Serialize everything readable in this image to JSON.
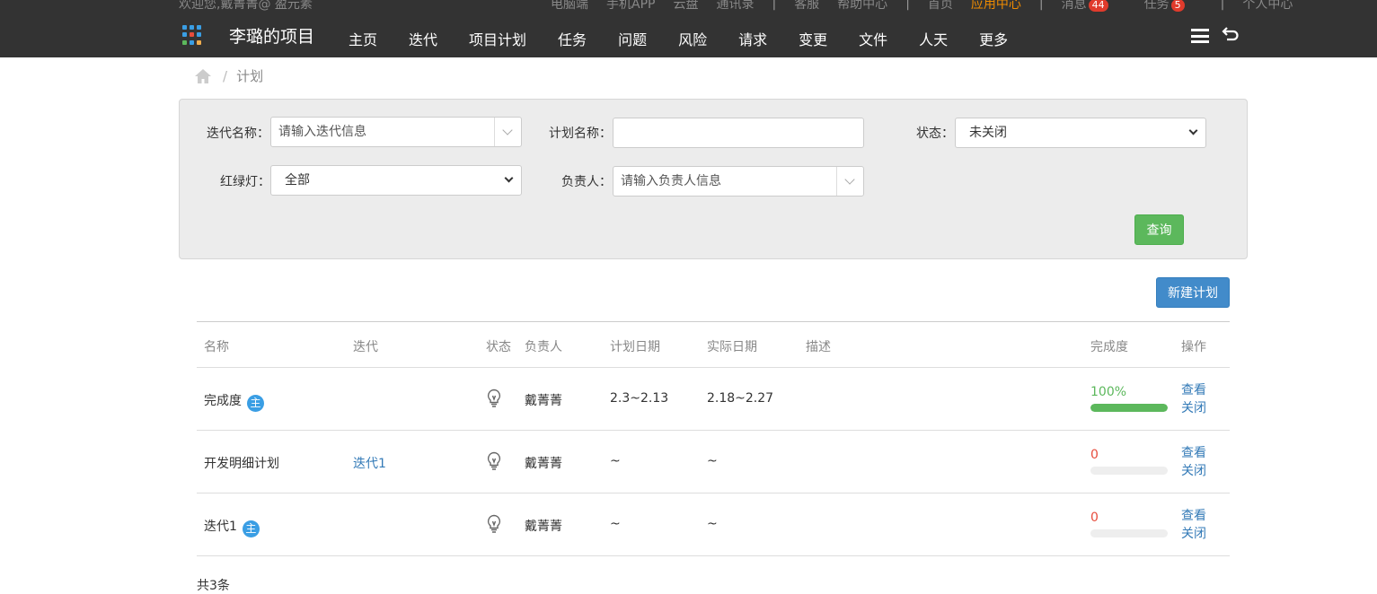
{
  "topbar": {
    "welcome": "欢迎您,戴菁菁@ 盈元素",
    "links": [
      "电脑端",
      "手机APP",
      "云盘",
      "通讯录"
    ],
    "links2": [
      "客服",
      "帮助中心"
    ],
    "home": "首页",
    "app_center": "应用中心",
    "messages": "消息",
    "messages_count": "44",
    "tasks": "任务",
    "tasks_count": "5",
    "personal": "个人中心"
  },
  "nav": {
    "project_title": "李璐的项目",
    "menu": [
      "主页",
      "迭代",
      "项目计划",
      "任务",
      "问题",
      "风险",
      "请求",
      "变更",
      "文件",
      "人天",
      "更多"
    ]
  },
  "breadcrumb": {
    "current": "计划"
  },
  "filter": {
    "iteration_label": "迭代名称：",
    "iteration_placeholder": "请输入迭代信息",
    "plan_name_label": "计划名称：",
    "plan_name_value": "",
    "status_label": "状态：",
    "status_value": "未关闭",
    "light_label": "红绿灯：",
    "light_value": "全部",
    "owner_label": "负责人：",
    "owner_placeholder": "请输入负责人信息",
    "query_button": "查询"
  },
  "new_plan_button": "新建计划",
  "table": {
    "columns": {
      "name": "名称",
      "iteration": "迭代",
      "status": "状态",
      "owner": "负责人",
      "plan_date": "计划日期",
      "actual_date": "实际日期",
      "desc": "描述",
      "progress": "完成度",
      "ops": "操作"
    },
    "main_badge": "主",
    "rows": [
      {
        "name": "完成度",
        "is_main": true,
        "iteration": "",
        "owner": "戴菁菁",
        "plan_date": "2.3~2.13",
        "actual_date": "2.18~2.27",
        "desc": "",
        "progress_text": "100%",
        "progress": 100,
        "progress_color": "#5cb85c",
        "view": "查看",
        "close": "关闭"
      },
      {
        "name": "开发明细计划",
        "is_main": false,
        "iteration": "迭代1",
        "owner": "戴菁菁",
        "plan_date": "~",
        "actual_date": "~",
        "desc": "",
        "progress_text": "0",
        "progress": 0,
        "progress_color": "#e74c3c",
        "view": "查看",
        "close": "关闭"
      },
      {
        "name": "迭代1",
        "is_main": true,
        "iteration": "",
        "owner": "戴菁菁",
        "plan_date": "~",
        "actual_date": "~",
        "desc": "",
        "progress_text": "0",
        "progress": 0,
        "progress_color": "#e74c3c",
        "view": "查看",
        "close": "关闭"
      }
    ]
  },
  "total": "共3条",
  "colors": {
    "accent": "#f08c00",
    "nav_bg": "#333333",
    "success": "#5cb85c",
    "primary": "#428bca",
    "danger": "#e74c3c",
    "main_badge": "#3a9ee4"
  }
}
